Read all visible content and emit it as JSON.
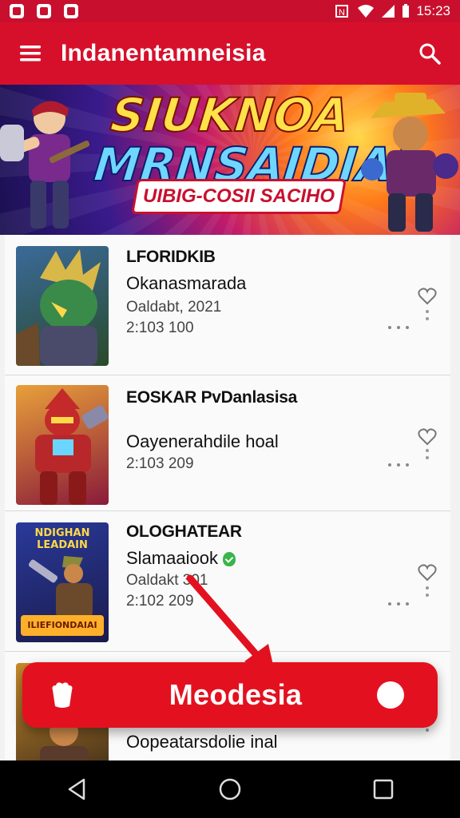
{
  "status_bar": {
    "time": "15:23"
  },
  "app_bar": {
    "title": "Indanentamneisia"
  },
  "banner": {
    "title_line1": "SIUKNOA",
    "title_line2": "MRNSAIDIAI",
    "subtitle": "UIBIG-COSII SACIHO"
  },
  "items": [
    {
      "title": "LFORIDKIB",
      "subtitle": "Okanasmarada",
      "meta1": "Oaldabt, 2021",
      "meta2": "2:103 100",
      "verified": false
    },
    {
      "title": "EOSKAR PvDanlasisa",
      "subtitle": "Oayenerahdile hoal",
      "meta1": "",
      "meta2": "2:103 209",
      "verified": false
    },
    {
      "title": "OLOGHATEAR",
      "subtitle": "Slamaaiook",
      "meta1": "Oaldakt 301",
      "meta2": "2:102 209",
      "verified": true
    },
    {
      "title": "",
      "subtitle": "Oopeatarsdolie inal",
      "meta1": "",
      "meta2": "",
      "verified": false
    }
  ],
  "thumb3_text": {
    "top": "NDIGHAN LEADAIN",
    "bottom": "ILIEFIONDAIAI"
  },
  "fab": {
    "label": "Meodesia"
  },
  "colors": {
    "primary": "#d6102b",
    "fab": "#e3111f",
    "verified": "#39b54a"
  },
  "icons": [
    "menu-icon",
    "search-icon",
    "heart-icon",
    "more-icon",
    "bag-icon",
    "back-icon",
    "home-icon",
    "recents-icon"
  ]
}
